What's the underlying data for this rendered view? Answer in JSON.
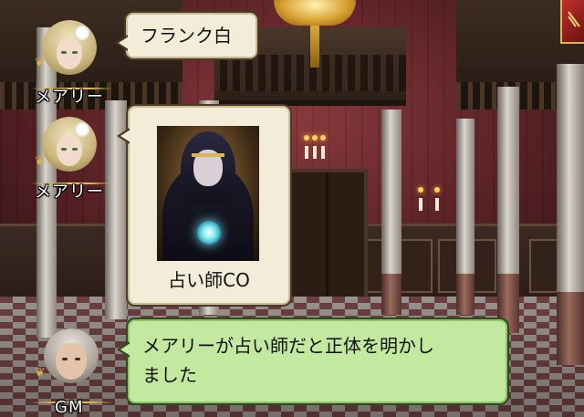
{
  "chat": [
    {
      "speaker": "メアリー",
      "text": "フランク白",
      "avatar_icon": "mary-portrait-icon"
    },
    {
      "speaker": "メアリー",
      "card_label": "占い師CO",
      "card_icon": "seer-card-icon",
      "avatar_icon": "mary-portrait-icon"
    },
    {
      "speaker": "GM",
      "text_line1": "メアリーが占い師だと正体を明かし",
      "text_line2": "ました",
      "avatar_icon": "gm-portrait-icon"
    }
  ],
  "colors": {
    "bubble_default": "#f2ecd9",
    "bubble_gm": "#c3e8a0",
    "menu_button": "#c0302c",
    "gold_accent": "#d5b04a"
  },
  "menu_icon": "menu-corner-icon"
}
